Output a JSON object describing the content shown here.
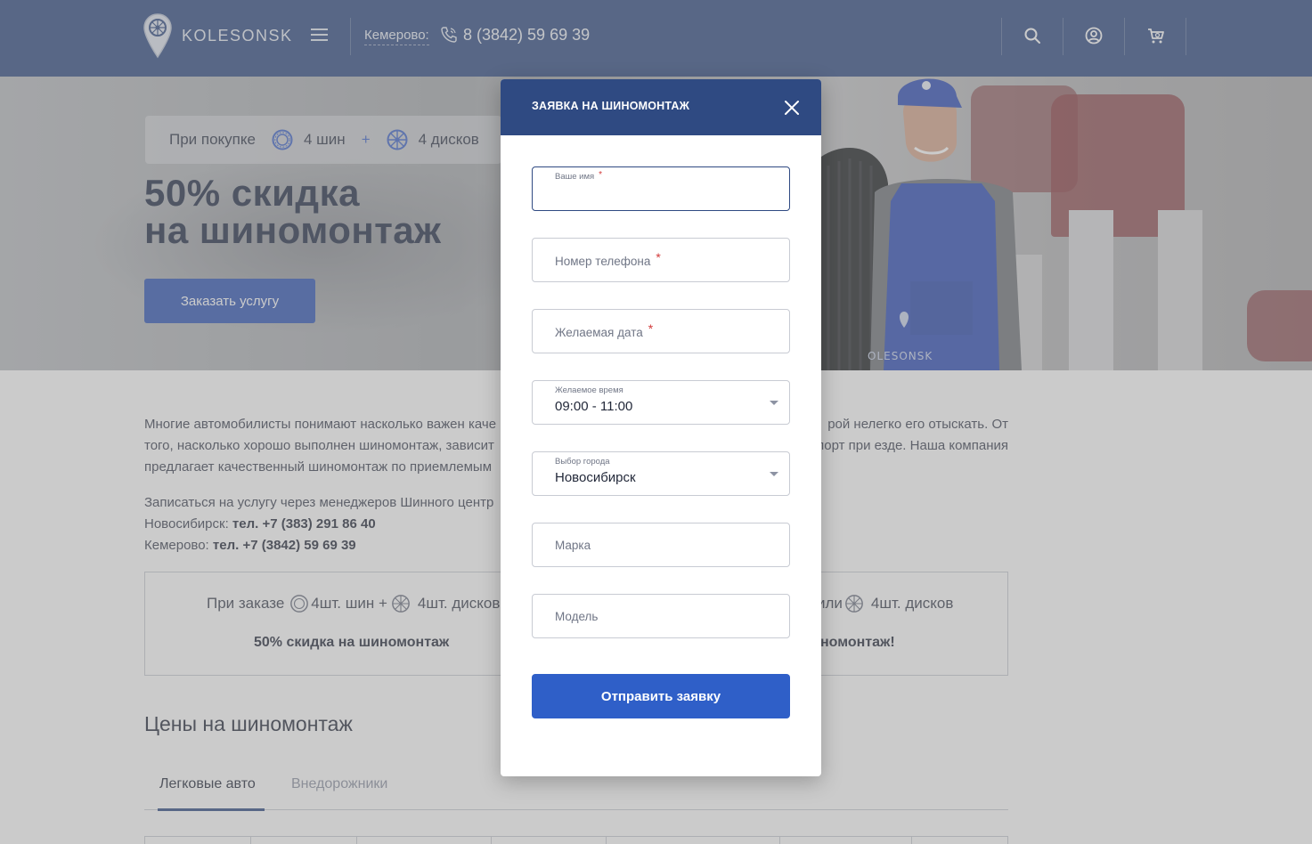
{
  "header": {
    "logo_text": "KOLESONSK",
    "city_label": "Кемерово:",
    "phone": "8 (3842) 59 69 39",
    "icons": [
      "search-icon",
      "user-icon",
      "cart-icon"
    ]
  },
  "hero": {
    "promo_prefix": "При покупке",
    "promo_tires": "4 шин",
    "promo_plus": "+",
    "promo_discs": "4 дисков",
    "title_line1": "50% скидка",
    "title_line2": "на шиномонтаж",
    "button_label": "Заказать услугу",
    "mechanic_badge": "OLESONSK"
  },
  "content": {
    "paragraph1_part1": "Многие автомобилисты понимают насколько важен каче",
    "paragraph1_part1b": "рой нелегко его отыскать. От",
    "paragraph1_part2": "того, насколько хорошо выполнен шиномонтаж, зависит",
    "paragraph1_part2b": "порт при езде. Наша компания",
    "paragraph1_part3": "предлагает качественный шиномонтаж по приемлемым",
    "signup_text": "Записаться на услугу через менеджеров Шинного центр",
    "nsk_label": "Новосибирск:",
    "nsk_phone": "тел. +7 (383) 291 86 40",
    "kem_label": "Кемерово:",
    "kem_phone": "тел. +7 (3842) 59 69 39"
  },
  "offer": {
    "left_prefix": "При заказе",
    "left_tires": "4шт. шин +",
    "left_discs": "4шт. дисков",
    "left_bold": "50% скидка на шиномонтаж",
    "right_prefix": "или",
    "right_discs": "4шт. дисков",
    "right_bold": "номонтаж!"
  },
  "prices": {
    "title": "Цены на шиномонтаж",
    "tabs": [
      {
        "label": "Легковые авто",
        "active": true
      },
      {
        "label": "Внедорожники",
        "active": false
      }
    ]
  },
  "modal": {
    "title": "ЗАЯВКА НА ШИНОМОНТАЖ",
    "fields": {
      "name_label": "Ваше имя",
      "phone_placeholder": "Номер телефона",
      "date_placeholder": "Желаемая дата",
      "time_label": "Желаемое время",
      "time_value": "09:00 - 11:00",
      "city_label": "Выбор города",
      "city_value": "Новосибирск",
      "brand_placeholder": "Марка",
      "model_placeholder": "Модель"
    },
    "required_mark": "*",
    "submit_label": "Отправить заявку"
  },
  "colors": {
    "header_bg": "#2f4a82",
    "accent": "#2f5fc8",
    "required": "#d23a3a"
  }
}
